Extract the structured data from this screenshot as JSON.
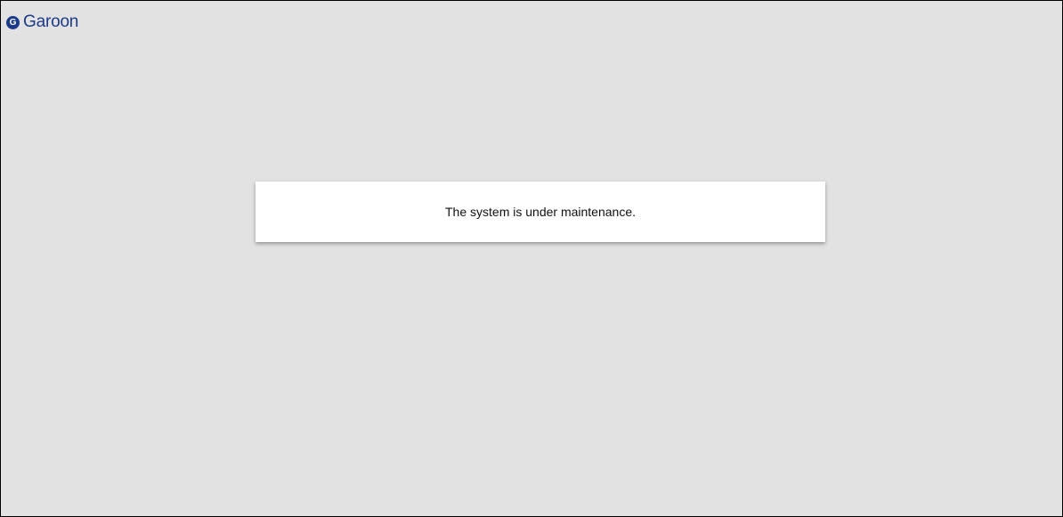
{
  "header": {
    "logo_icon": "garoon-g-icon",
    "logo_icon_glyph": "G",
    "logo_text": "Garoon"
  },
  "main": {
    "message": "The system is under maintenance."
  },
  "colors": {
    "background": "#e2e2e2",
    "brand": "#1c3a8a",
    "panel": "#ffffff"
  }
}
